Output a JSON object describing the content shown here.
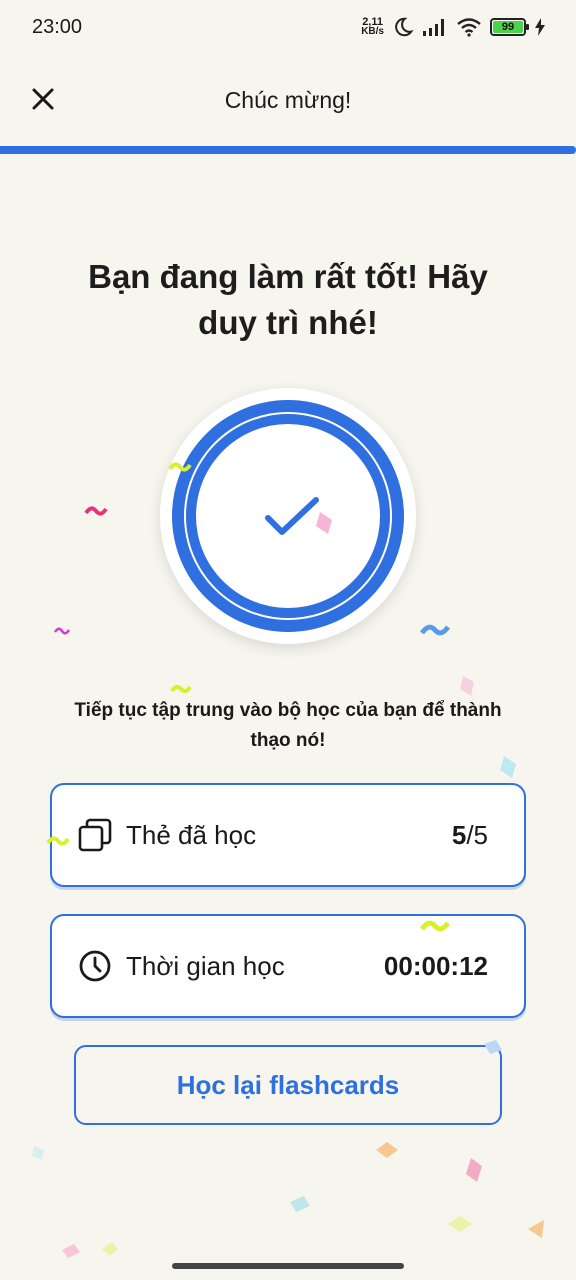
{
  "status_bar": {
    "time": "23:00",
    "net_speed_value": "2,11",
    "net_speed_unit": "KB/s",
    "battery_level": "99",
    "icons": [
      "moon-icon",
      "signal-icon",
      "wifi-icon",
      "battery-icon",
      "charging-icon"
    ]
  },
  "header": {
    "title": "Chúc mừng!",
    "close_icon": "close-icon",
    "progress": 1.0
  },
  "main": {
    "headline": "Bạn đang làm rất tốt! Hãy duy trì nhé!",
    "badge_icon": "check-icon",
    "subtext": "Tiếp tục tập trung vào bộ học của bạn để thành thạo nó!"
  },
  "stats": {
    "cards": {
      "label": "Thẻ đã học",
      "learned": "5",
      "total": "/5",
      "icon": "cards-icon"
    },
    "time": {
      "label": "Thời gian học",
      "value": "00:00:12",
      "icon": "clock-icon"
    }
  },
  "actions": {
    "relearn_label": "Học lại flashcards"
  },
  "colors": {
    "accent": "#2f6fe0",
    "background": "#f6f6ef",
    "battery": "#4cd34a"
  }
}
